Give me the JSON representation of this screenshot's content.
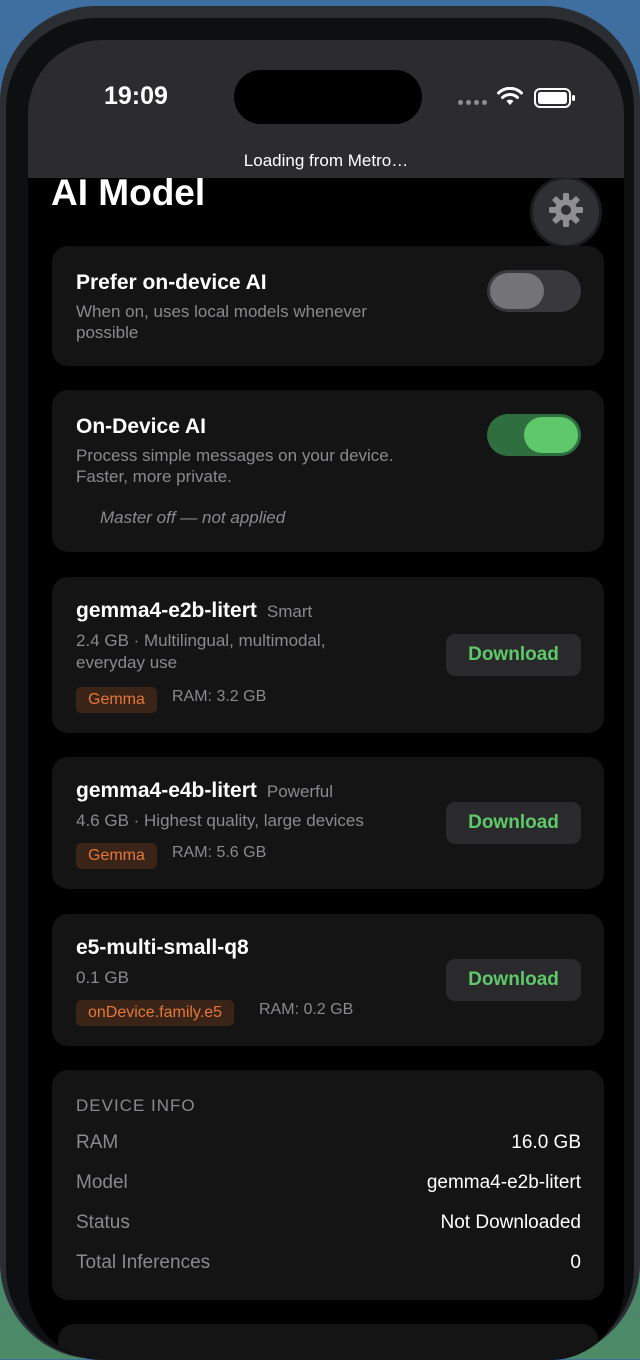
{
  "status_bar": {
    "time": "19:09",
    "loading_text": "Loading from Metro…"
  },
  "page": {
    "title": "AI Model",
    "settings_icon": "gear-icon"
  },
  "prefer_on_device": {
    "title": "Prefer on-device AI",
    "description_line1": "When on, uses local models whenever",
    "description_line2": "possible",
    "enabled": false
  },
  "on_device_ai": {
    "title": "On-Device AI",
    "description_line1": "Process simple messages on your device.",
    "description_line2": "Faster, more private.",
    "note": "Master off — not applied",
    "enabled": true
  },
  "models": [
    {
      "name": "gemma4-e2b-litert",
      "tag": "Smart",
      "desc_line1": "2.4 GB · Multilingual, multimodal,",
      "desc_line2": "everyday use",
      "family": "Gemma",
      "ram": "RAM: 3.2 GB",
      "action": "Download"
    },
    {
      "name": "gemma4-e4b-litert",
      "tag": "Powerful",
      "desc_line1": "4.6 GB · Highest quality, large devices",
      "family": "Gemma",
      "ram": "RAM: 5.6 GB",
      "action": "Download"
    },
    {
      "name": "e5-multi-small-q8",
      "desc_line1": "0.1 GB",
      "family": "onDevice.family.e5",
      "ram": "RAM: 0.2 GB",
      "action": "Download"
    }
  ],
  "device_info": {
    "header": "DEVICE INFO",
    "rows": [
      {
        "label": "RAM",
        "value": "16.0 GB"
      },
      {
        "label": "Model",
        "value": "gemma4-e2b-litert"
      },
      {
        "label": "Status",
        "value": "Not Downloaded"
      },
      {
        "label": "Total Inferences",
        "value": "0"
      }
    ]
  },
  "colors": {
    "accent_green": "#5ec86a",
    "badge_orange": "#e4773a",
    "card_bg": "#141414"
  }
}
